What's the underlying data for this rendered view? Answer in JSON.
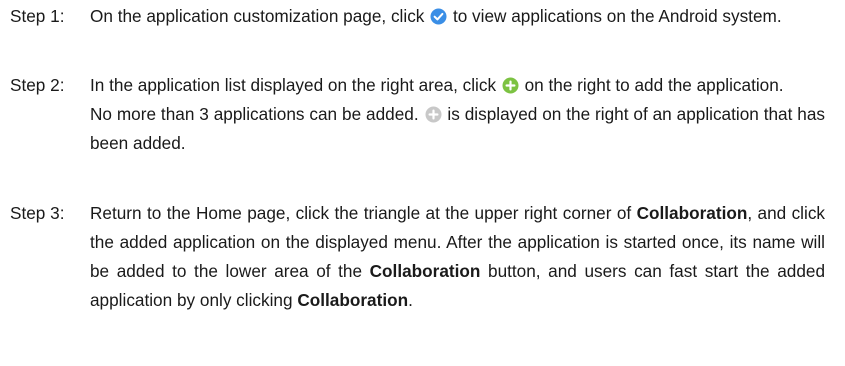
{
  "steps": [
    {
      "label": "Step 1:",
      "before_icon": "On the application customization page, click",
      "icon": "check-circle-icon",
      "after_icon": "to view applications on the Android system."
    },
    {
      "label": "Step 2:",
      "para1_before_icon": "In the application list displayed on the right area, click",
      "para1_icon": "add-circle-icon",
      "para1_after_icon": "on the right to add the application.",
      "para2_before_icon": "No more than 3 applications can be added.",
      "para2_icon": "added-circle-icon",
      "para2_after_icon": "is displayed on the right of an application that has been added."
    },
    {
      "label": "Step 3:",
      "t1": "Return to the Home page, click the triangle at the upper right corner of",
      "b1": "Collaboration",
      "t2": ", and click the added application on the displayed menu. After the application is started once, its name will be added to the lower area of the",
      "b2": "Collaboration",
      "t3": "button, and users can fast start the added application by only clicking",
      "b3": "Collaboration",
      "t4": "."
    }
  ],
  "colors": {
    "text": "#1a1a1a",
    "check_icon": "#3a8ee6",
    "add_icon": "#7cc242",
    "added_icon": "#c8c8c8"
  }
}
